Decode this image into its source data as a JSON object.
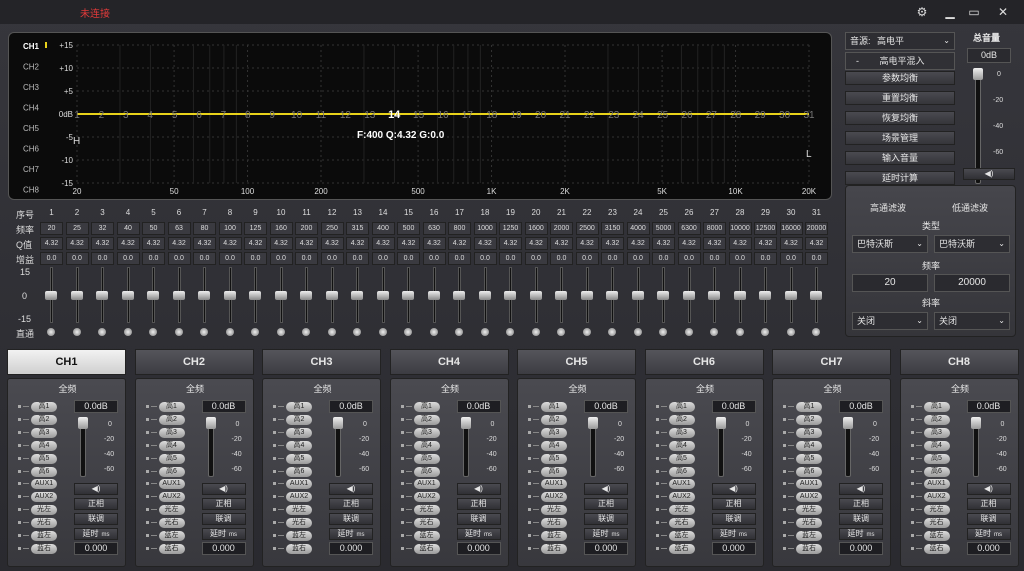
{
  "titlebar": {
    "status": "未连接"
  },
  "graph": {
    "channels": [
      "CH1",
      "CH2",
      "CH3",
      "CH4",
      "CH5",
      "CH6",
      "CH7",
      "CH8"
    ],
    "active_channel": "CH1",
    "y_ticks": [
      "+15",
      "+10",
      "+5",
      "0dB",
      "-5",
      "-10",
      "-15"
    ],
    "x_ticks": [
      "20",
      "50",
      "100",
      "200",
      "500",
      "1K",
      "2K",
      "5K",
      "10K",
      "20K"
    ],
    "band_numbers": [
      "1",
      "2",
      "3",
      "4",
      "5",
      "6",
      "7",
      "8",
      "9",
      "10",
      "11",
      "12",
      "13",
      "14",
      "15",
      "16",
      "17",
      "18",
      "19",
      "20",
      "21",
      "22",
      "23",
      "24",
      "25",
      "26",
      "27",
      "28",
      "29",
      "30",
      "31"
    ],
    "selected_band": "14",
    "info": "F:400 Q:4.32 G:0.0",
    "left_marker": "H",
    "right_marker": "L",
    "curve_color": "#e8d21a"
  },
  "bands": {
    "labels": {
      "index": "序号",
      "freq": "频率",
      "q": "Q值",
      "gain": "增益",
      "bypass": "直通",
      "scale_top": "15",
      "scale_mid": "0",
      "scale_bot": "-15"
    },
    "freqs": [
      "20",
      "25",
      "32",
      "40",
      "50",
      "63",
      "80",
      "100",
      "125",
      "160",
      "200",
      "250",
      "315",
      "400",
      "500",
      "630",
      "800",
      "1000",
      "1250",
      "1600",
      "2000",
      "2500",
      "3150",
      "4000",
      "5000",
      "6300",
      "8000",
      "10000",
      "12500",
      "16000",
      "20000"
    ],
    "q": "4.32",
    "gain": "0.0"
  },
  "right": {
    "source_label": "音源:",
    "source_value": "高电平",
    "mix_label": "高电平混入",
    "mix_prefix": "-",
    "buttons": [
      "参数均衡",
      "重置均衡",
      "恢复均衡",
      "场景管理",
      "输入音量",
      "延时计算"
    ]
  },
  "master": {
    "title": "总音量",
    "value": "0dB",
    "scale": [
      "0",
      "-20",
      "-40",
      "-60"
    ],
    "mute_icon": "speaker-icon"
  },
  "crossover": {
    "hp_title": "高通滤波",
    "lp_title": "低通滤波",
    "type_label": "类型",
    "hp_type": "巴特沃斯",
    "lp_type": "巴特沃斯",
    "freq_label": "频率",
    "hp_freq": "20",
    "lp_freq": "20000",
    "slope_label": "斜率",
    "hp_slope": "关闭",
    "lp_slope": "关闭"
  },
  "channels": [
    {
      "name": "CH1"
    },
    {
      "name": "CH2"
    },
    {
      "name": "CH3"
    },
    {
      "name": "CH4"
    },
    {
      "name": "CH5"
    },
    {
      "name": "CH6"
    },
    {
      "name": "CH7"
    },
    {
      "name": "CH8"
    }
  ],
  "strip": {
    "title": "全频",
    "sources": [
      "高1",
      "高2",
      "高3",
      "高4",
      "高5",
      "高6",
      "AUX1",
      "AUX2",
      "光左",
      "光右",
      "蓝左",
      "蓝右"
    ],
    "level": "0.0dB",
    "scale": [
      "0",
      "-20",
      "-40",
      "-60"
    ],
    "buttons": {
      "phase": "正相",
      "link": "联调",
      "delay": "延时",
      "delay_unit": "ms",
      "delay_value": "0.000"
    }
  }
}
